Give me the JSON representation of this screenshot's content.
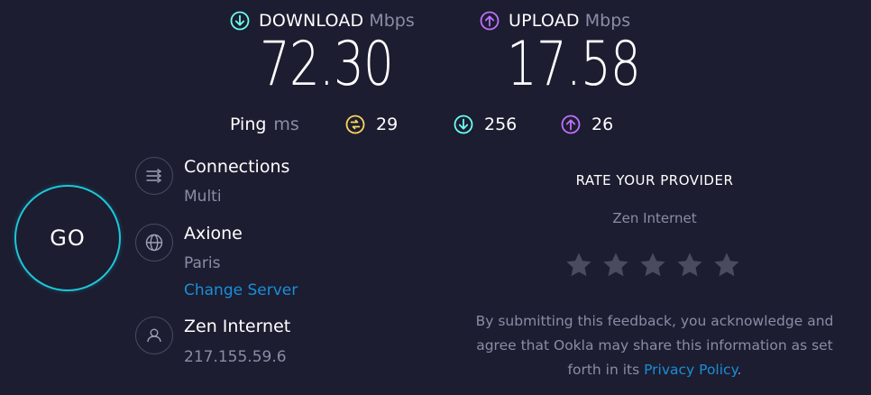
{
  "results": {
    "download": {
      "label": "DOWNLOAD",
      "unit": "Mbps",
      "value": "72.30",
      "icon": "download-arrow-icon",
      "color": "#6afff3"
    },
    "upload": {
      "label": "UPLOAD",
      "unit": "Mbps",
      "value": "17.58",
      "icon": "upload-arrow-icon",
      "color": "#bf71ff"
    }
  },
  "ping": {
    "label": "Ping",
    "unit": "ms",
    "idle": {
      "value": "29",
      "icon": "idle-latency-icon",
      "color": "#fbd85c"
    },
    "download": {
      "value": "256",
      "icon": "download-latency-icon",
      "color": "#6afff3"
    },
    "upload": {
      "value": "26",
      "icon": "upload-latency-icon",
      "color": "#bf71ff"
    }
  },
  "go_button": {
    "label": "GO",
    "color": "#1dc7d9"
  },
  "connections": {
    "title": "Connections",
    "value": "Multi",
    "icon": "connections-icon"
  },
  "server": {
    "title": "Axione",
    "location": "Paris",
    "change_link": "Change Server",
    "icon": "globe-icon"
  },
  "isp": {
    "title": "Zen Internet",
    "ip": "217.155.59.6",
    "icon": "user-icon"
  },
  "rate": {
    "title": "RATE YOUR PROVIDER",
    "provider": "Zen Internet",
    "stars": 5,
    "rating": 0,
    "disclaimer_line1": "By submitting this feedback, you acknowledge and",
    "disclaimer_line2": "agree that Ookla may share this information as set",
    "disclaimer_pre": "forth in its ",
    "disclaimer_link": "Privacy Policy",
    "disclaimer_post": "."
  },
  "colors": {
    "background": "#1c1d30",
    "muted": "#8b8ca6",
    "link": "#1a8ed8",
    "star": "#4a4b5e"
  }
}
